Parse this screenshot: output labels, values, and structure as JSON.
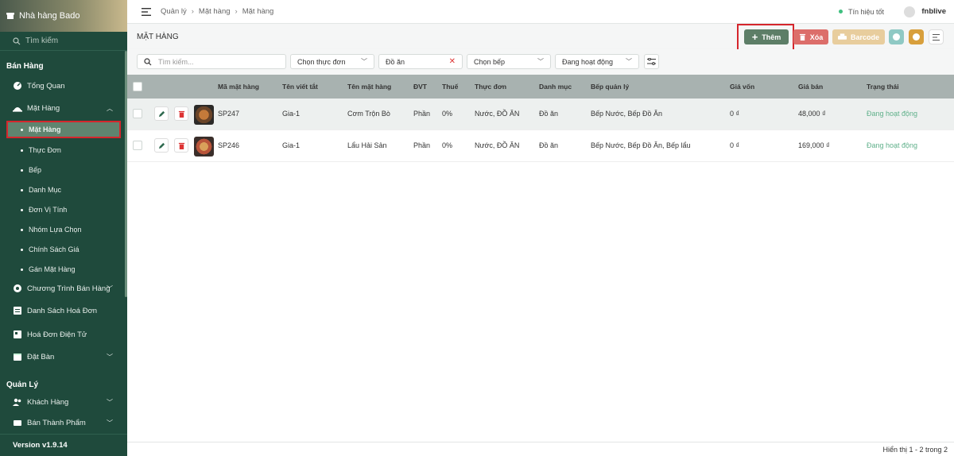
{
  "sidebar": {
    "store_name": "Nhà hàng Bado",
    "search_placeholder": "Tìm kiếm",
    "section_sales": "Bán Hàng",
    "section_manage": "Quản Lý",
    "items": {
      "overview": "Tổng Quan",
      "products": "Mặt Hàng",
      "sales_program": "Chương Trình Bán Hàng",
      "invoice_list": "Danh Sách Hoá Đơn",
      "e_invoice": "Hoá Đơn Điện Tử",
      "booking": "Đặt Bàn",
      "customers": "Khách Hàng",
      "semi_products": "Bán Thành Phẩm"
    },
    "sub_items": [
      "Mặt Hàng",
      "Thực Đơn",
      "Bếp",
      "Danh Mục",
      "Đơn Vị Tính",
      "Nhóm Lựa Chọn",
      "Chính Sách Giá",
      "Gán Mặt Hàng"
    ],
    "version": "Version v1.9.14"
  },
  "topbar": {
    "breadcrumb": [
      "Quản lý",
      "Mặt hàng",
      "Mặt hàng"
    ],
    "signal": "Tín hiệu tốt",
    "username": "fnblive"
  },
  "page": {
    "title": "MẶT HÀNG",
    "add_label": "Thêm",
    "delete_label": "Xóa",
    "barcode_label": "Barcode"
  },
  "filters": {
    "search_placeholder": "Tìm kiếm...",
    "menu": "Chọn thực đơn",
    "category": "Đồ ăn",
    "kitchen": "Chọn bếp",
    "status": "Đang hoạt động"
  },
  "table": {
    "headers": {
      "code": "Mã mặt hàng",
      "short": "Tên viết tắt",
      "name": "Tên mặt hàng",
      "unit": "ĐVT",
      "tax": "Thuế",
      "menu": "Thực đơn",
      "category": "Danh mục",
      "kitchen": "Bếp quản lý",
      "cost": "Giá vốn",
      "price": "Giá bán",
      "status": "Trạng thái"
    },
    "rows": [
      {
        "code": "SP247",
        "short": "Gia-1",
        "name": "Cơm Trộn Bò",
        "unit": "Phần",
        "tax": "0%",
        "menu": "Nước, ĐỒ ĂN",
        "category": "Đồ ăn",
        "kitchen": "Bếp Nước, Bếp Đồ Ăn",
        "cost": "0 ₫",
        "price": "48,000 ₫",
        "status": "Đang hoạt động"
      },
      {
        "code": "SP246",
        "short": "Gia-1",
        "name": "Lẩu Hải Sản",
        "unit": "Phần",
        "tax": "0%",
        "menu": "Nước, ĐỒ ĂN",
        "category": "Đồ ăn",
        "kitchen": "Bếp Nước, Bếp Đồ Ăn, Bếp lẩu",
        "cost": "0 ₫",
        "price": "169,000 ₫",
        "status": "Đang hoạt động"
      }
    ]
  },
  "footer": {
    "pagination": "Hiển thị 1 - 2 trong 2"
  },
  "colors": {
    "sidebar": "#1f4a3c",
    "accent": "#5d7e67",
    "danger": "#dc6e6a",
    "highlight": "#d5262c"
  }
}
